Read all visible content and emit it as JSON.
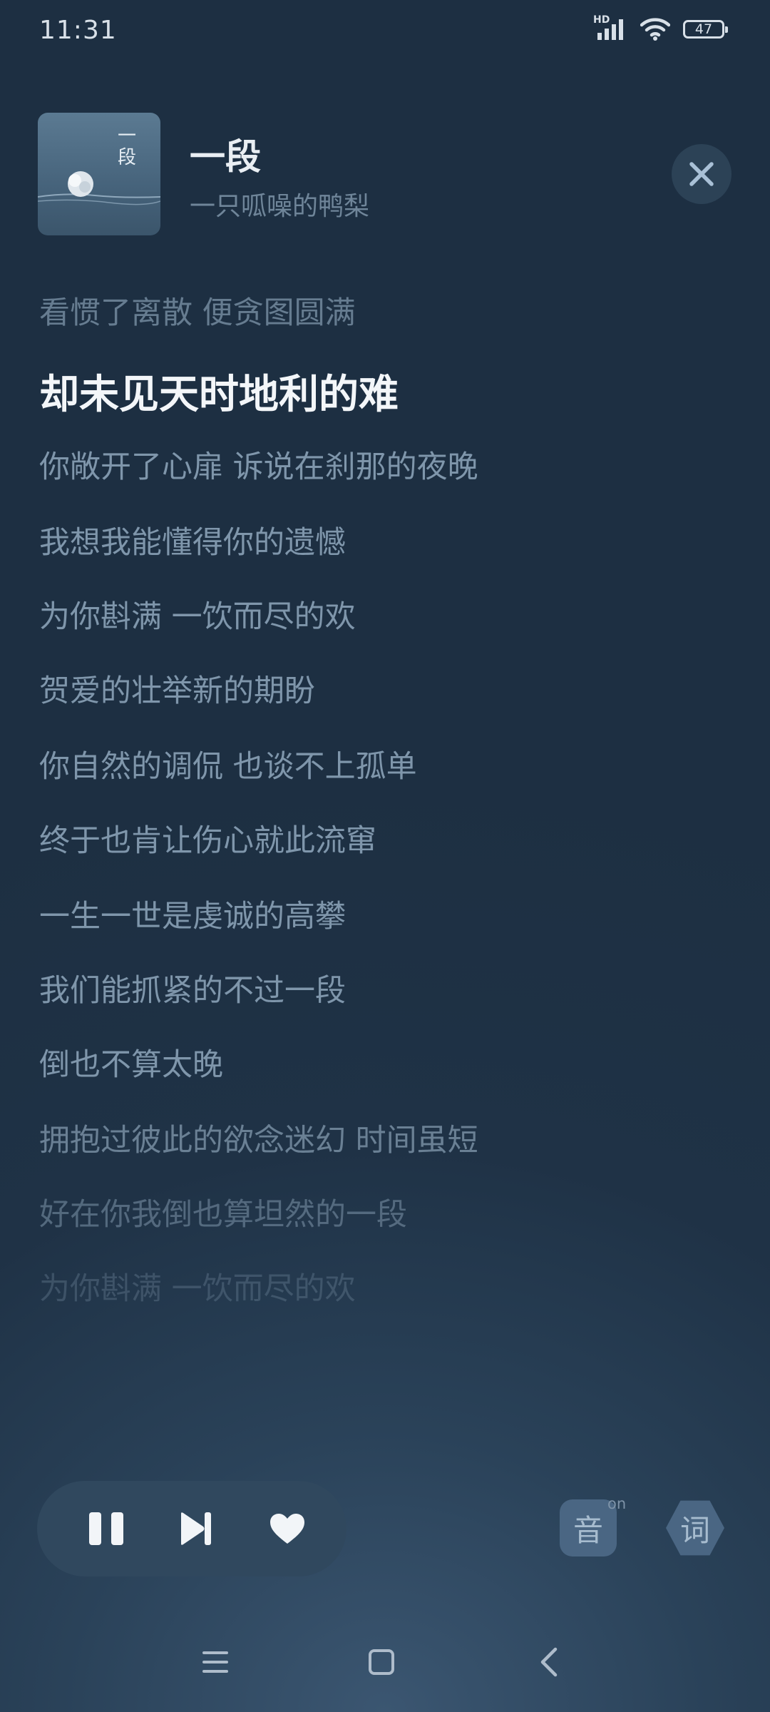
{
  "status_bar": {
    "time": "11:31",
    "network_label": "HD",
    "battery": "47",
    "icons": [
      "signal-icon",
      "wifi-icon",
      "battery-icon"
    ]
  },
  "song": {
    "title": "一段",
    "artist": "一只呱噪的鸭梨",
    "album_art_text": "一段"
  },
  "lyrics": {
    "current_index": 1,
    "lines": [
      "看惯了离散 便贪图圆满",
      "却未见天时地利的难",
      "你敞开了心扉 诉说在刹那的夜晚",
      "我想我能懂得你的遗憾",
      "为你斟满 一饮而尽的欢",
      "贺爱的壮举新的期盼",
      "你自然的调侃 也谈不上孤单",
      "终于也肯让伤心就此流窜",
      "一生一世是虔诚的高攀",
      "我们能抓紧的不过一段",
      "倒也不算太晚",
      "拥抱过彼此的欲念迷幻 时间虽短",
      "好在你我倒也算坦然的一段",
      "为你斟满 一饮而尽的欢"
    ]
  },
  "controls": {
    "pause": "pause-icon",
    "next": "next-track-icon",
    "like": "heart-icon",
    "sound_label": "音",
    "sound_state": "on",
    "lyrics_label": "词"
  },
  "nav": {
    "icons": [
      "menu-icon",
      "home-icon",
      "back-icon"
    ]
  },
  "colors": {
    "background": "#1e3043",
    "current_lyric": "#f3f6f9",
    "lyric": "#7f96ab",
    "pill": "#30485e"
  }
}
